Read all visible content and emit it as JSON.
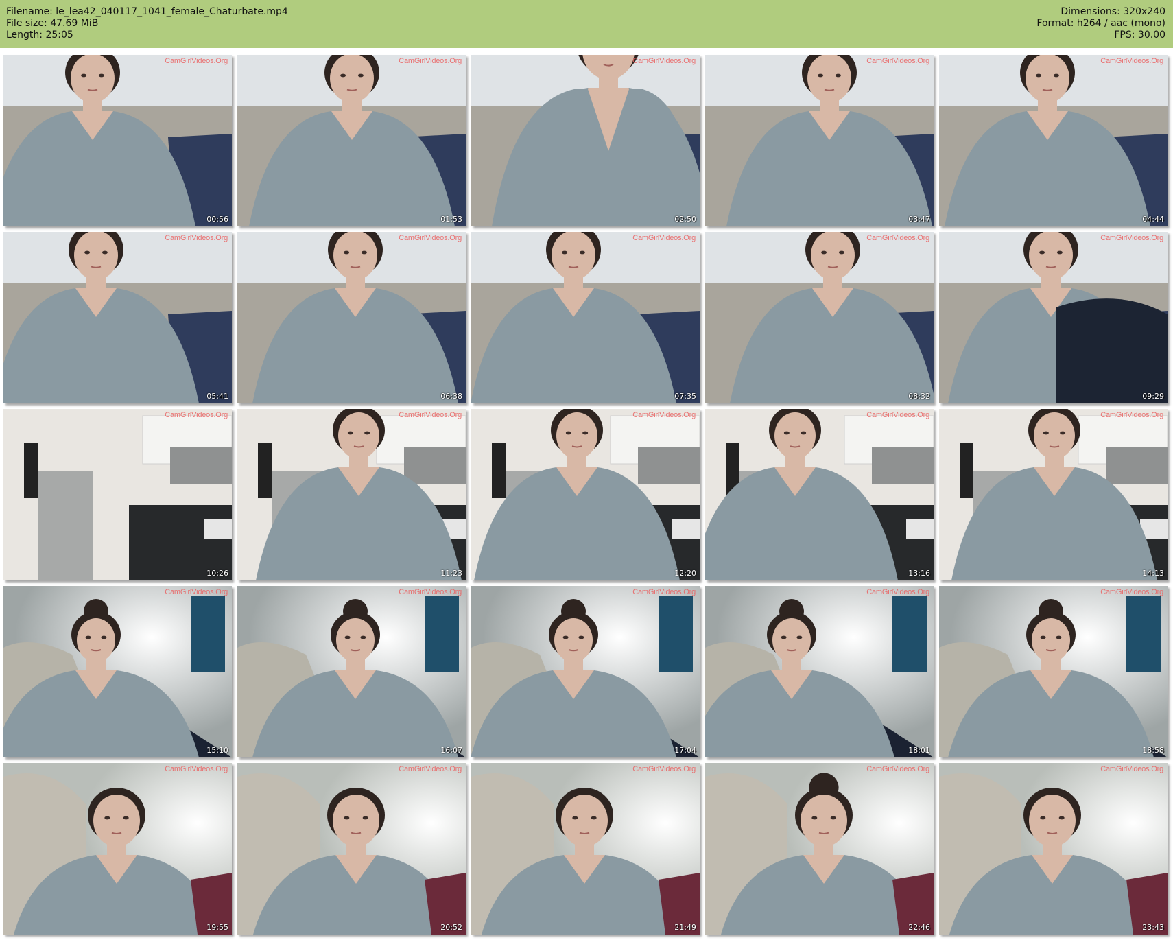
{
  "header": {
    "filename": "Filename: le_lea42_040117_1041_female_Chaturbate.mp4",
    "filesize": "File size: 47.69 MiB",
    "length": "Length: 25:05",
    "dimensions": "Dimensions: 320x240",
    "format": "Format: h264 / aac (mono)",
    "fps": "FPS: 30.00"
  },
  "colors": {
    "header_bg": "#b0cc7e",
    "sweater": "#8a9aa2",
    "wall": "#dfe3e6",
    "couch": "#a9a59c",
    "kitchen": "#e9e6e1",
    "hair": "#2e2420",
    "skin": "#d8b8a6"
  },
  "thumbnails": [
    {
      "time": "00:56",
      "scene": "couch",
      "watermark": "CamGirlVideos.Org"
    },
    {
      "time": "01:53",
      "scene": "couch",
      "watermark": "CamGirlVideos.Org"
    },
    {
      "time": "02:50",
      "scene": "closeup",
      "watermark": "CamGirlVideos.Org"
    },
    {
      "time": "03:47",
      "scene": "couch",
      "watermark": "CamGirlVideos.Org"
    },
    {
      "time": "04:44",
      "scene": "couch",
      "watermark": "CamGirlVideos.Org"
    },
    {
      "time": "05:41",
      "scene": "couch",
      "watermark": "CamGirlVideos.Org"
    },
    {
      "time": "06:38",
      "scene": "couch",
      "watermark": "CamGirlVideos.Org"
    },
    {
      "time": "07:35",
      "scene": "couch",
      "watermark": "CamGirlVideos.Org"
    },
    {
      "time": "08:32",
      "scene": "couch",
      "watermark": "CamGirlVideos.Org"
    },
    {
      "time": "09:29",
      "scene": "couch-dark",
      "watermark": "CamGirlVideos.Org"
    },
    {
      "time": "10:26",
      "scene": "kitchen-empty",
      "watermark": "CamGirlVideos.Org"
    },
    {
      "time": "11:23",
      "scene": "kitchen",
      "watermark": "CamGirlVideos.Org"
    },
    {
      "time": "12:20",
      "scene": "kitchen",
      "watermark": "CamGirlVideos.Org"
    },
    {
      "time": "13:16",
      "scene": "kitchen",
      "watermark": "CamGirlVideos.Org"
    },
    {
      "time": "14:13",
      "scene": "kitchen",
      "watermark": "CamGirlVideos.Org"
    },
    {
      "time": "15:10",
      "scene": "bedroom",
      "watermark": "CamGirlVideos.Org"
    },
    {
      "time": "16:07",
      "scene": "bedroom",
      "watermark": "CamGirlVideos.Org"
    },
    {
      "time": "17:04",
      "scene": "bedroom",
      "watermark": "CamGirlVideos.Org"
    },
    {
      "time": "18:01",
      "scene": "bedroom",
      "watermark": "CamGirlVideos.Org"
    },
    {
      "time": "18:58",
      "scene": "bedroom",
      "watermark": "CamGirlVideos.Org"
    },
    {
      "time": "19:55",
      "scene": "pillow",
      "watermark": "CamGirlVideos.Org"
    },
    {
      "time": "20:52",
      "scene": "pillow",
      "watermark": "CamGirlVideos.Org"
    },
    {
      "time": "21:49",
      "scene": "pillow",
      "watermark": "CamGirlVideos.Org"
    },
    {
      "time": "22:46",
      "scene": "pillow",
      "watermark": "CamGirlVideos.Org"
    },
    {
      "time": "23:43",
      "scene": "pillow",
      "watermark": "CamGirlVideos.Org"
    }
  ]
}
